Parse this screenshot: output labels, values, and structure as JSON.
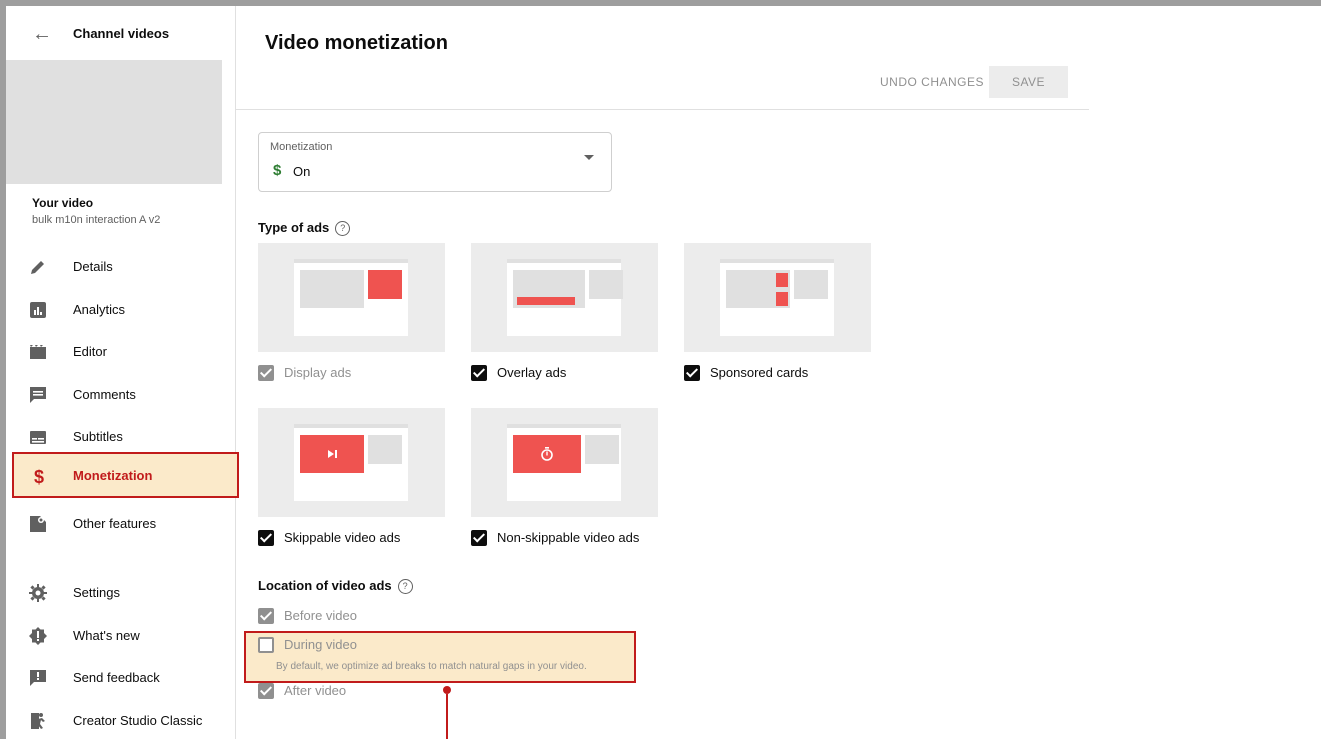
{
  "sidebar": {
    "back_label": "Channel videos",
    "your_video_label": "Your video",
    "video_name": "bulk m10n interaction A v2",
    "items": [
      {
        "label": "Details",
        "icon": "pencil-icon"
      },
      {
        "label": "Analytics",
        "icon": "analytics-icon"
      },
      {
        "label": "Editor",
        "icon": "clapperboard-icon"
      },
      {
        "label": "Comments",
        "icon": "comments-icon"
      },
      {
        "label": "Subtitles",
        "icon": "subtitles-icon"
      },
      {
        "label": "Monetization",
        "icon": "dollar-icon"
      },
      {
        "label": "Other features",
        "icon": "other-features-icon"
      },
      {
        "label": "Settings",
        "icon": "gear-icon"
      },
      {
        "label": "What's new",
        "icon": "whats-new-icon"
      },
      {
        "label": "Send feedback",
        "icon": "feedback-icon"
      },
      {
        "label": "Creator Studio Classic",
        "icon": "classic-exit-icon"
      }
    ]
  },
  "main": {
    "title": "Video monetization",
    "undo_label": "UNDO CHANGES",
    "save_label": "SAVE",
    "monetization": {
      "label": "Monetization",
      "value": "On",
      "symbol": "$"
    },
    "type_of_ads": {
      "title": "Type of ads",
      "help": "?",
      "options": [
        {
          "label": "Display ads",
          "state": "checked-disabled"
        },
        {
          "label": "Overlay ads",
          "state": "checked"
        },
        {
          "label": "Sponsored cards",
          "state": "checked"
        },
        {
          "label": "Skippable video ads",
          "state": "checked"
        },
        {
          "label": "Non-skippable video ads",
          "state": "checked"
        }
      ]
    },
    "location": {
      "title": "Location of video ads",
      "help": "?",
      "options": [
        {
          "label": "Before video",
          "state": "checked-disabled"
        },
        {
          "label": "During video",
          "state": "unchecked",
          "description": "By default, we optimize ad breaks to match natural gaps in your video."
        },
        {
          "label": "After video",
          "state": "checked-disabled"
        }
      ]
    }
  },
  "colors": {
    "accent_red": "#c11b1b",
    "ad_red": "#ef5350",
    "highlight": "#fbeaca",
    "dollar_green": "#2e7d32"
  }
}
